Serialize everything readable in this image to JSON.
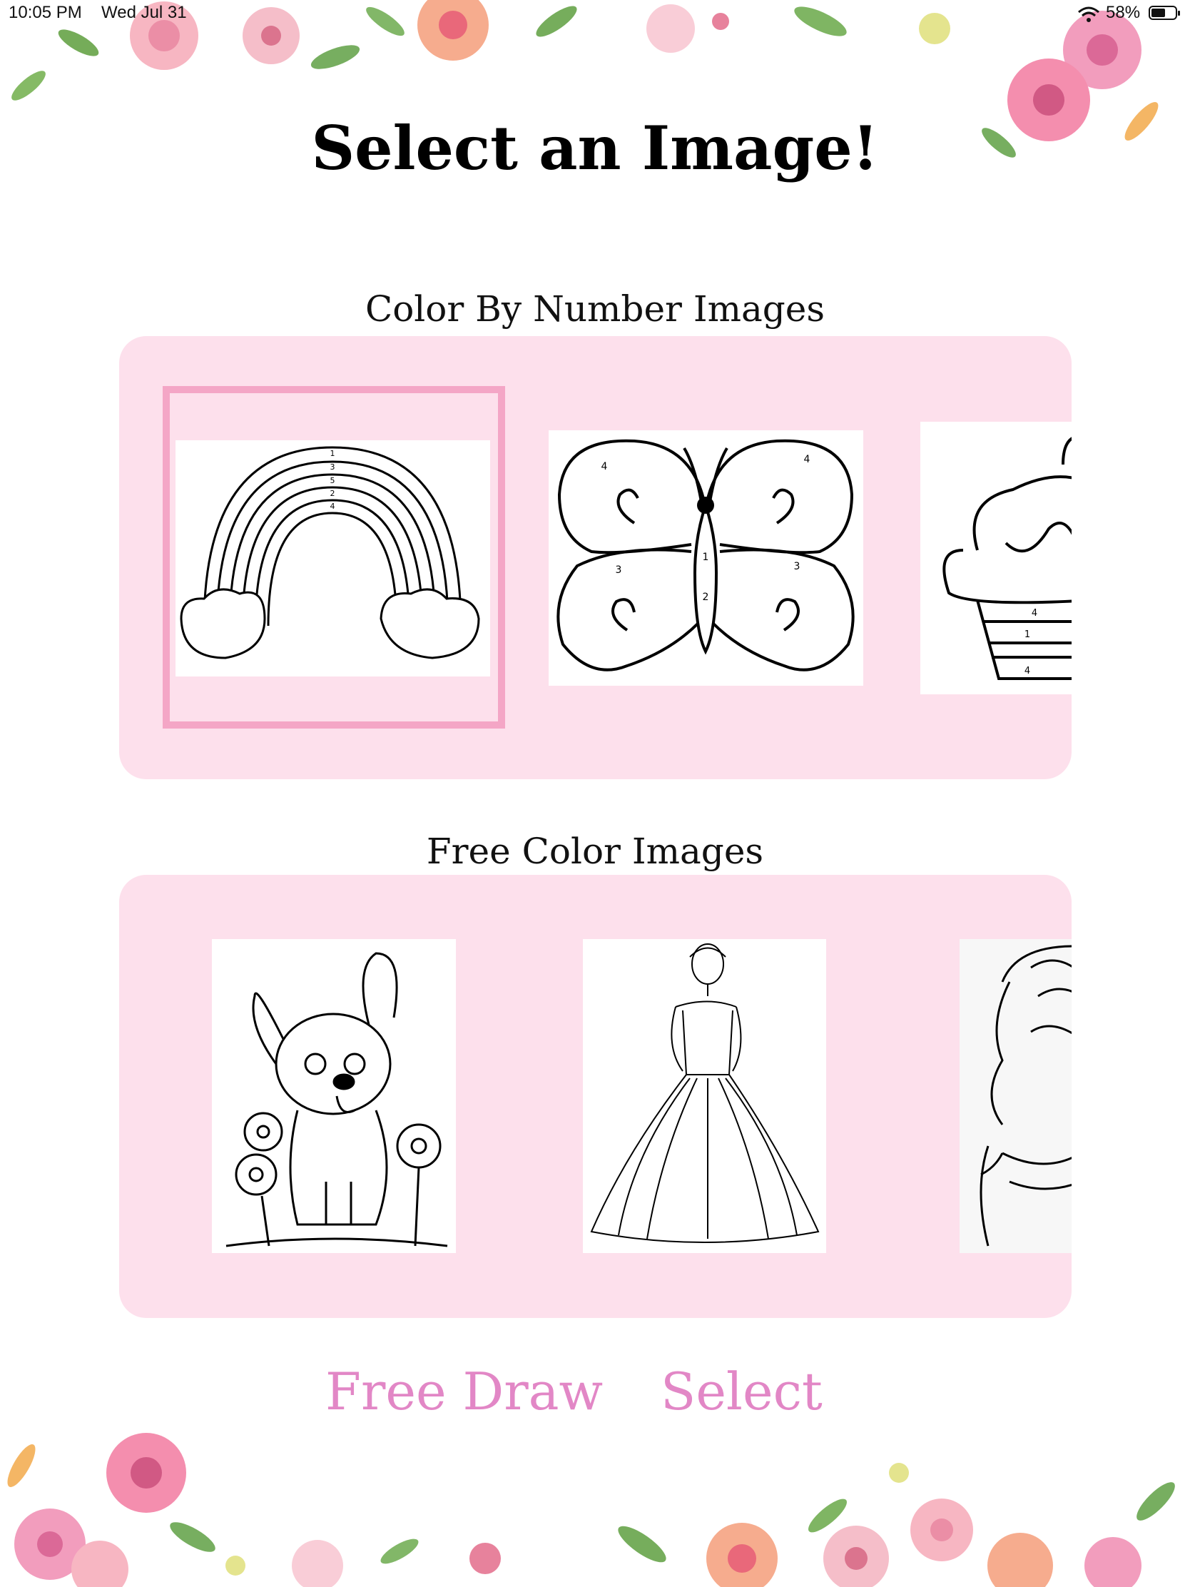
{
  "status_bar": {
    "time": "10:05 PM",
    "date": "Wed Jul 31",
    "battery": "58%",
    "battery_level": 0.58,
    "icons": [
      "wifi-icon",
      "battery-icon"
    ]
  },
  "title": "Select an Image!",
  "color_by_number": {
    "heading": "Color By Number Images",
    "items": [
      {
        "name": "rainbow",
        "selected": true,
        "labels": [
          "1",
          "3",
          "5",
          "2",
          "4"
        ]
      },
      {
        "name": "butterfly",
        "selected": false,
        "labels": [
          "4",
          "4",
          "3",
          "3",
          "1",
          "2"
        ]
      },
      {
        "name": "cupcake",
        "selected": false,
        "labels": [
          "4",
          "1",
          "4"
        ]
      }
    ]
  },
  "free_color": {
    "heading": "Free Color Images",
    "items": [
      {
        "name": "puppy"
      },
      {
        "name": "princess"
      },
      {
        "name": "girl"
      }
    ]
  },
  "buttons": {
    "free_draw": "Free Draw",
    "select": "Select"
  },
  "colors": {
    "panel": "#fde0ec",
    "accent": "#e287c6",
    "selection": "#f4a6c6"
  }
}
